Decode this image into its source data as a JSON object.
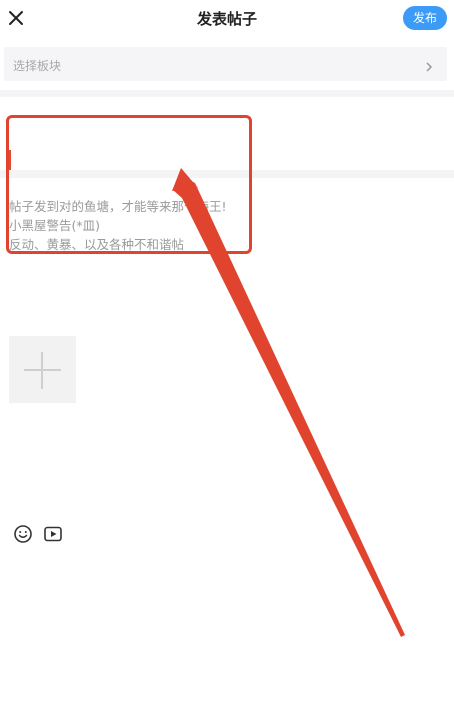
{
  "header": {
    "title": "发表帖子",
    "publish_label": "发布",
    "close_icon": "close-icon"
  },
  "board_selector": {
    "placeholder": "选择板块",
    "chevron_icon": "chevron-right-icon"
  },
  "title_field": {
    "value": "",
    "placeholder": ""
  },
  "content_hint": {
    "lines": [
      "帖子发到对的鱼塘，才能等来那个海王!",
      "小黑屋警告(*皿)",
      "反动、黄暴、以及各种不和谐帖"
    ]
  },
  "media": {
    "upload_icon": "plus-icon"
  },
  "toolbar": {
    "emoji_icon": "emoji-icon",
    "video_icon": "video-icon"
  },
  "annotation": {
    "color": "#e0442e"
  },
  "colors": {
    "accent": "#3b9bf7",
    "annotation_red": "#e0442e",
    "hint_text": "#9a9a9a"
  }
}
